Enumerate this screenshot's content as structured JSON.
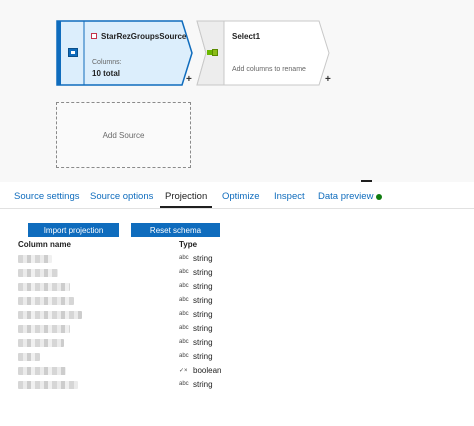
{
  "colors": {
    "accent": "#0f6cbd",
    "source_node_fill": "#dceefc",
    "source_node_border": "#0f6cbd",
    "status_ok": "#107c10"
  },
  "canvas": {
    "source_node": {
      "title": "StarRezGroupsSource",
      "columns_label": "Columns:",
      "columns_value": "10 total",
      "plus": "+",
      "icon": "database-icon"
    },
    "select_node": {
      "title": "Select1",
      "subtitle": "Add columns to rename",
      "plus": "+",
      "icon": "select-transform-icon"
    },
    "add_source_label": "Add Source"
  },
  "tabs": [
    {
      "label": "Source settings",
      "active": false
    },
    {
      "label": "Source options",
      "active": false
    },
    {
      "label": "Projection",
      "active": true
    },
    {
      "label": "Optimize",
      "active": false
    },
    {
      "label": "Inspect",
      "active": false
    },
    {
      "label": "Data preview",
      "active": false
    }
  ],
  "projection": {
    "import_label": "Import projection",
    "reset_label": "Reset schema",
    "column_header": "Column name",
    "type_header": "Type",
    "rows": [
      {
        "type_icon": "abc",
        "type": "string"
      },
      {
        "type_icon": "abc",
        "type": "string"
      },
      {
        "type_icon": "abc",
        "type": "string"
      },
      {
        "type_icon": "abc",
        "type": "string"
      },
      {
        "type_icon": "abc",
        "type": "string"
      },
      {
        "type_icon": "abc",
        "type": "string"
      },
      {
        "type_icon": "abc",
        "type": "string"
      },
      {
        "type_icon": "abc",
        "type": "string"
      },
      {
        "type_icon": "✓×",
        "type": "boolean"
      },
      {
        "type_icon": "abc",
        "type": "string"
      }
    ]
  }
}
